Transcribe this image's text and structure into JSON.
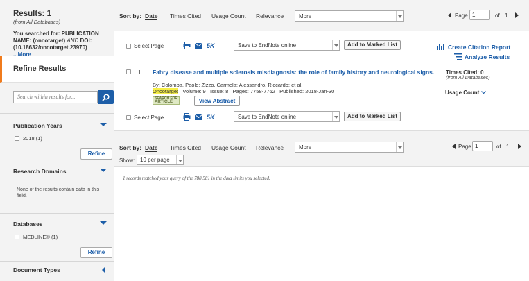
{
  "sidebar": {
    "results_label": "Results: 1",
    "results_from": "(from All Databases)",
    "searched_prefix": "You searched for: PUBLICATION NAME: (oncotarget)",
    "searched_and": "AND",
    "searched_suffix": "DOI: (10.18632/oncotarget.23970)",
    "more_link": "...More",
    "refine_title": "Refine Results",
    "search_placeholder": "Search within results for...",
    "facets": {
      "pub_years": {
        "title": "Publication Years",
        "option": "2018 (1)",
        "refine": "Refine"
      },
      "research_domains": {
        "title": "Research Domains",
        "note": "None of the results contain data in this field."
      },
      "databases": {
        "title": "Databases",
        "option": "MEDLINE® (1)",
        "refine": "Refine"
      },
      "doc_types": {
        "title": "Document Types"
      }
    }
  },
  "sort": {
    "label": "Sort by:",
    "options": [
      "Date",
      "Times Cited",
      "Usage Count",
      "Relevance"
    ],
    "more": "More"
  },
  "pager": {
    "page_label": "Page",
    "page_value": "1",
    "of_label": "of",
    "total": "1"
  },
  "toolbar": {
    "select_page": "Select Page",
    "five_k": "5K",
    "save_select": "Save to EndNote online",
    "add_marked": "Add to Marked List",
    "create_citation": "Create Citation Report",
    "analyze": "Analyze Results"
  },
  "record": {
    "number": "1.",
    "title": "Fabry disease and multiple sclerosis misdiagnosis: the role of family history and neurological signs.",
    "authors": "By: Colomba, Paolo; Zizzo, Carmela; Alessandro, Riccardo; et al.",
    "journal": "Oncotarget",
    "volume": "Volume: 9",
    "issue": "Issue: 8",
    "pages": "Pages: 7758-7762",
    "published": "Published: 2018-Jan-30",
    "badge_top": "SEARCH FOR",
    "badge_bottom": "ARTICLE",
    "view_abstract": "View Abstract",
    "times_cited": "Times Cited: 0",
    "times_cited_from": "(from All Databases)",
    "usage_count": "Usage Count"
  },
  "show": {
    "label": "Show:",
    "value": "10 per page"
  },
  "matched_text": "1 records matched your query of the 788,581 in the data limits you selected.",
  "colors": {
    "accent": "#1d5ea8",
    "refine_bar": "#f07b1c",
    "highlight": "#f6ef47"
  }
}
